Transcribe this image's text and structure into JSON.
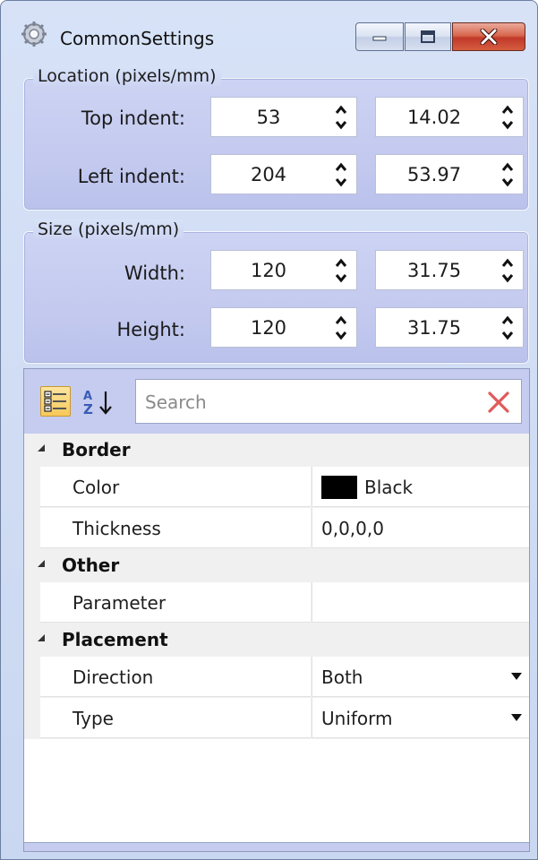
{
  "window": {
    "title": "CommonSettings",
    "controls": {
      "minimize": "minimize-icon",
      "maximize": "maximize-icon",
      "close": "close-icon"
    }
  },
  "location": {
    "title": "Location (pixels/mm)",
    "top": {
      "label": "Top indent:",
      "pixels": "53",
      "mm": "14.02"
    },
    "left": {
      "label": "Left indent:",
      "pixels": "204",
      "mm": "53.97"
    }
  },
  "size": {
    "title": "Size (pixels/mm)",
    "width": {
      "label": "Width:",
      "pixels": "120",
      "mm": "31.75"
    },
    "height": {
      "label": "Height:",
      "pixels": "120",
      "mm": "31.75"
    }
  },
  "property_grid": {
    "search_placeholder": "Search",
    "sort_categorized_icon": "categorized-icon",
    "sort_alpha_icon": "sort-az-icon",
    "categories": [
      {
        "label": "Border",
        "properties": [
          {
            "name": "Color",
            "value": "Black",
            "swatch": "#000000"
          },
          {
            "name": "Thickness",
            "value": "0,0,0,0"
          }
        ]
      },
      {
        "label": "Other",
        "properties": [
          {
            "name": "Parameter",
            "value": ""
          }
        ]
      },
      {
        "label": "Placement",
        "properties": [
          {
            "name": "Direction",
            "value": "Both",
            "dropdown": true
          },
          {
            "name": "Type",
            "value": "Uniform",
            "dropdown": true
          }
        ]
      }
    ]
  },
  "colors": {
    "window_bg": "#d7e2f7",
    "group_bg": "#c4caef",
    "close_button": "#c1392a",
    "close_x": "#e05a5a"
  }
}
